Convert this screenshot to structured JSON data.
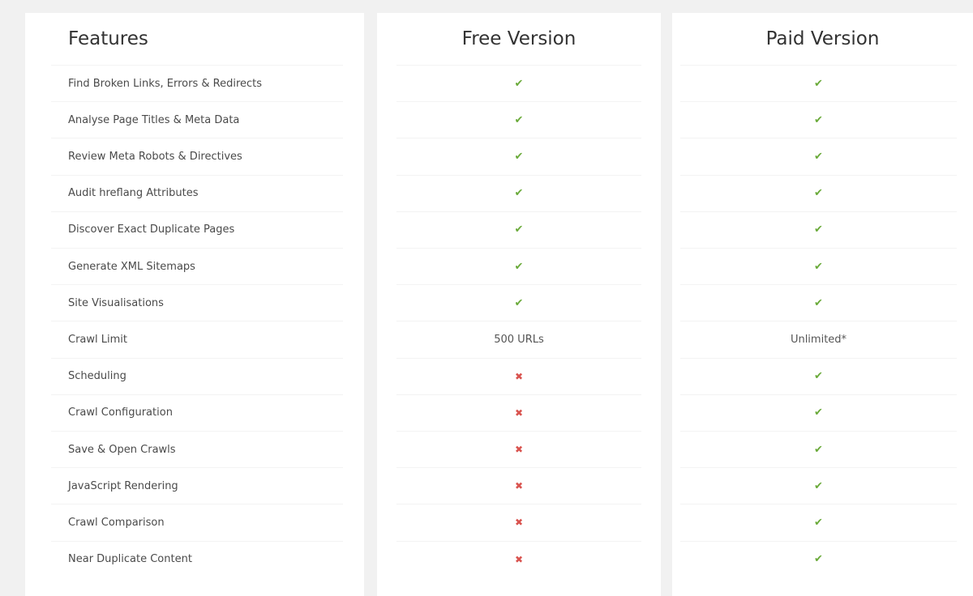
{
  "headers": {
    "features": "Features",
    "free": "Free Version",
    "paid": "Paid Version"
  },
  "rows": [
    {
      "feature": "Find Broken Links, Errors & Redirects",
      "free": "check",
      "paid": "check"
    },
    {
      "feature": "Analyse Page Titles & Meta Data",
      "free": "check",
      "paid": "check"
    },
    {
      "feature": "Review Meta Robots & Directives",
      "free": "check",
      "paid": "check"
    },
    {
      "feature": "Audit hreflang Attributes",
      "free": "check",
      "paid": "check"
    },
    {
      "feature": "Discover Exact Duplicate Pages",
      "free": "check",
      "paid": "check"
    },
    {
      "feature": "Generate XML Sitemaps",
      "free": "check",
      "paid": "check"
    },
    {
      "feature": "Site Visualisations",
      "free": "check",
      "paid": "check"
    },
    {
      "feature": "Crawl Limit",
      "free": "500 URLs",
      "paid": "Unlimited*"
    },
    {
      "feature": "Scheduling",
      "free": "cross",
      "paid": "check"
    },
    {
      "feature": "Crawl Configuration",
      "free": "cross",
      "paid": "check"
    },
    {
      "feature": "Save & Open Crawls",
      "free": "cross",
      "paid": "check"
    },
    {
      "feature": "JavaScript Rendering",
      "free": "cross",
      "paid": "check"
    },
    {
      "feature": "Crawl Comparison",
      "free": "cross",
      "paid": "check"
    },
    {
      "feature": "Near Duplicate Content",
      "free": "cross",
      "paid": "check"
    }
  ],
  "icons": {
    "check": {
      "name": "check-icon",
      "glyph": "✔",
      "color": "#6aaa3a"
    },
    "cross": {
      "name": "cross-icon",
      "glyph": "✖",
      "color": "#d9534f"
    }
  }
}
